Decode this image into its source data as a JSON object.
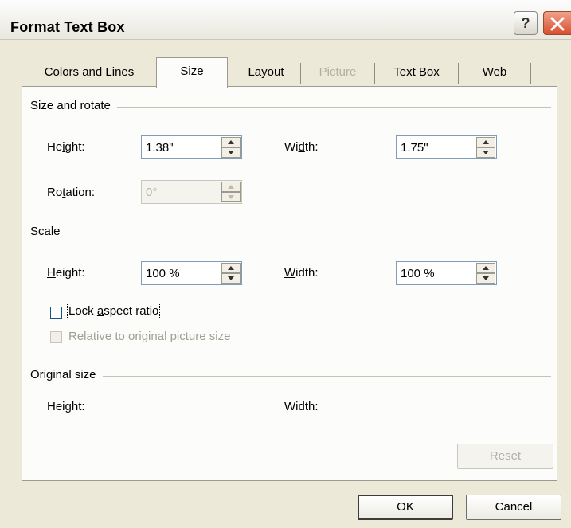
{
  "window": {
    "title": "Format Text Box"
  },
  "title_buttons": {
    "help_glyph": "?"
  },
  "tabs": [
    {
      "label": "Colors and Lines"
    },
    {
      "label": "Size"
    },
    {
      "label": "Layout"
    },
    {
      "label": "Picture"
    },
    {
      "label": "Text Box"
    },
    {
      "label": "Web"
    }
  ],
  "size_rotate": {
    "section": "Size and rotate",
    "height_label": {
      "pre": "He",
      "key": "i",
      "post": "ght:"
    },
    "height_value": "1.38\"",
    "width_label": {
      "pre": "Wi",
      "key": "d",
      "post": "th:"
    },
    "width_value": "1.75\"",
    "rotation_label": {
      "pre": "Ro",
      "key": "t",
      "post": "ation:"
    },
    "rotation_value": "0°"
  },
  "scale": {
    "section": "Scale",
    "height_label": {
      "pre": "",
      "key": "H",
      "post": "eight:"
    },
    "height_value": "100 %",
    "width_label": {
      "pre": "",
      "key": "W",
      "post": "idth:"
    },
    "width_value": "100 %",
    "lock_label": {
      "pre": "Lock ",
      "key": "a",
      "post": "spect ratio"
    },
    "lock_checked": false,
    "relative_label": "Relative to original picture size",
    "relative_checked": false
  },
  "original": {
    "section": "Original size",
    "height_label": "Height:",
    "width_label": "Width:",
    "reset_label": "Reset"
  },
  "footer": {
    "ok_label": "OK",
    "cancel_label": "Cancel"
  },
  "colors": {
    "dialog_bg": "#ece9d8",
    "panel_bg": "#fcfcfa",
    "close_red": "#d7502e",
    "input_border": "#7f9db9"
  }
}
